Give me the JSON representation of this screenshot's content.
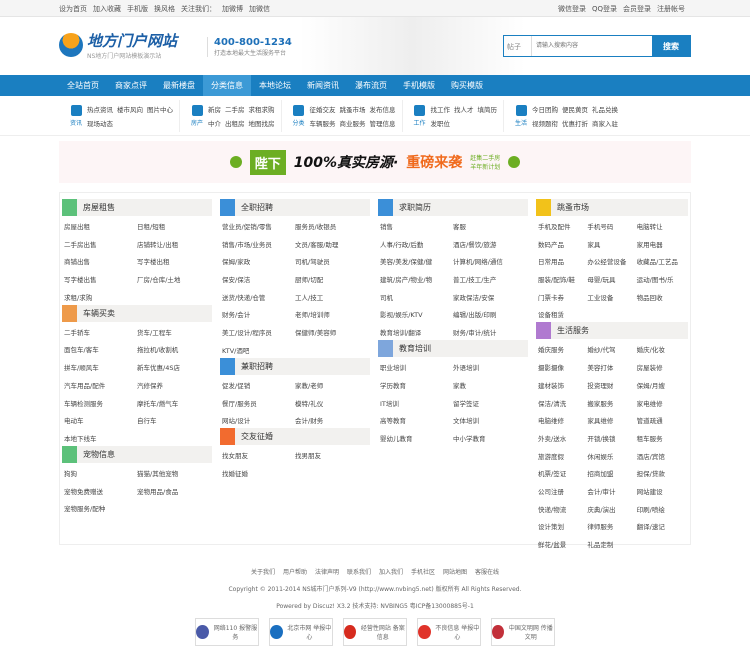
{
  "topbar": {
    "left": [
      "设为首页",
      "加入收藏",
      "手机版",
      "换风格",
      "关注我们：",
      "加微博",
      "加微信"
    ],
    "right": [
      "微信登录",
      "QQ登录",
      "会员登录",
      "注册帐号"
    ]
  },
  "header": {
    "logo_title": "地方门户网站",
    "logo_sub": "NS地方门户网站模板演示站",
    "phone": "400-800-1234",
    "slogan": "打造本地最大生活服务平台",
    "search_type": "帖子",
    "search_placeholder": "请输入搜索内容",
    "search_button": "搜索"
  },
  "nav": [
    "全站首页",
    "商家点评",
    "最新楼盘",
    "分类信息",
    "本地论坛",
    "新闻资讯",
    "瀑布流页",
    "手机模版",
    "购买模版"
  ],
  "subnav": [
    {
      "label": "资讯",
      "links": [
        "热点资讯",
        "楼市风向",
        "图片中心",
        "现场动态"
      ]
    },
    {
      "label": "房产",
      "links": [
        "新房",
        "二手房",
        "求租求购",
        "中介",
        "出租房",
        "地图找房"
      ]
    },
    {
      "label": "分类",
      "links": [
        "征婚交友",
        "跳蚤市场",
        "发布信息",
        "车辆服务",
        "商业服务",
        "管理信息"
      ]
    },
    {
      "label": "工作",
      "links": [
        "找工作",
        "找人才",
        "填简历",
        "发职位"
      ]
    },
    {
      "label": "生活",
      "links": [
        "今日团购",
        "便民黄页",
        "礼品兑换",
        "视频题衔",
        "优惠打折",
        "商家入驻"
      ]
    }
  ],
  "banner": {
    "tag": "陛下",
    "headline": "100%真实房源·",
    "highlight": "重磅来袭",
    "side": "赶集二手房 羊年新计划"
  },
  "columns": [
    [
      {
        "title": "房屋租售",
        "color": "#5cc17a",
        "items": [
          "房屋出租",
          "日租/短租",
          "二手房出售",
          "店铺转让/出租",
          "商铺出售",
          "写字楼出租",
          "写字楼出售",
          "厂房/仓库/土地",
          "求租/求购"
        ]
      },
      {
        "title": "车辆买卖",
        "color": "#ee9a4a",
        "items": [
          "二手轿车",
          "货车/工程车",
          "面包车/客车",
          "拖拉机/收割机",
          "拼车/顺风车",
          "新车优惠/4S店",
          "汽车用品/配件",
          "汽修保养",
          "车辆检测服务",
          "摩托车/燃气车",
          "电动车",
          "自行车",
          "本地下线车"
        ]
      },
      {
        "title": "宠物信息",
        "color": "#5cc17a",
        "items": [
          "狗狗",
          "猫猫/其他宠物",
          "宠物免费赠送",
          "宠物用品/食品",
          "宠物服务/配种"
        ]
      }
    ],
    [
      {
        "title": "全职招聘",
        "color": "#3b8fd8",
        "items": [
          "营业员/促销/零售",
          "服务员/收银员",
          "销售/市场/业务员",
          "文员/客服/助理",
          "保姆/家政",
          "司机/驾驶员",
          "保安/保洁",
          "厨师/切配",
          "送货/快递/仓管",
          "工人/技工",
          "财务/会计",
          "老师/培训师",
          "美工/设计/程序员",
          "保健师/美容师",
          "KTV/酒吧"
        ]
      },
      {
        "title": "兼职招聘",
        "color": "#3b8fd8",
        "items": [
          "促发/促销",
          "家教/老师",
          "餐厅/服务员",
          "模特/礼仪",
          "网站/设计",
          "会计/财务"
        ]
      },
      {
        "title": "交友征婚",
        "color": "#f26b2f",
        "items": [
          "找女朋友",
          "找男朋友",
          "找婚征婚"
        ]
      }
    ],
    [
      {
        "title": "求职简历",
        "color": "#3b8fd8",
        "items": [
          "销售",
          "客服",
          "人事/行政/后勤",
          "酒店/餐饮/旅游",
          "美容/美发/保健/健",
          "计算机/网络/通信",
          "建筑/房产/物业/物",
          "普工/技工/生产",
          "司机",
          "家政保洁/安保",
          "影视/娱乐/KTV",
          "编辑/出版/印刷",
          "教育培训/翻译",
          "财务/审计/统计"
        ]
      },
      {
        "title": "教育培训",
        "color": "#7ea6dc",
        "items": [
          "职业培训",
          "外语培训",
          "学历教育",
          "家教",
          "IT培训",
          "留学签证",
          "高等教育",
          "文体培训",
          "婴幼儿教育",
          "中小学教育"
        ]
      }
    ],
    [
      {
        "title": "跳蚤市场",
        "color": "#f2c21a",
        "three": true,
        "items": [
          "手机及配件",
          "手机号码",
          "电脑转让",
          "数码产品",
          "家具",
          "家用电器",
          "日常用品",
          "办公经营设备",
          "收藏品/工艺品",
          "服装/配饰/鞋",
          "母婴/玩具",
          "运动/图书/乐",
          "门票卡券",
          "工业设备",
          "物品回收",
          "设备租赁"
        ]
      },
      {
        "title": "生活服务",
        "color": "#b07ad0",
        "three": true,
        "items": [
          "婚庆服务",
          "婚纱/代驾",
          "婚庆/化妆",
          "摄影摄像",
          "美容打体",
          "房屋装修",
          "建材装饰",
          "投资理财",
          "保姆/月嫂",
          "保洁/清洗",
          "搬家服务",
          "家电维修",
          "电脑维修",
          "家具维修",
          "管道疏通",
          "外卖/送水",
          "开锁/换锁",
          "租车服务",
          "旅游度假",
          "休闲娱乐",
          "酒店/宾馆",
          "机票/签证",
          "招商加盟",
          "担保/贷款",
          "公司注册",
          "会计/审计",
          "网站建设",
          "快递/物流",
          "庆典/演出",
          "印刷/喷绘",
          "设计策划",
          "律师服务",
          "翻译/速记",
          "鲜花/盆景",
          "礼品定制"
        ]
      }
    ]
  ],
  "footer": {
    "links": [
      "关于我们",
      "用户帮助",
      "法律声明",
      "联系我们",
      "加入我们",
      "手机社区",
      "网站地图",
      "客服在线"
    ],
    "copyright": "Copyright © 2011-2014 NS城市门户系列-V9 (http://www.nvbing5.net) 版权所有 All Rights Reserved.",
    "powered": "Powered by Discuz! X3.2 技术支持: NVBING5 粤ICP备13000885号-1",
    "badges": [
      {
        "text": "网络110 报警服务",
        "color": "#4a5aa8"
      },
      {
        "text": "北京市网 举报中心",
        "color": "#1a6fc0"
      },
      {
        "text": "经营性网站 备案信息",
        "color": "#d62b1e"
      },
      {
        "text": "不良信息 举报中心",
        "color": "#e0332a"
      },
      {
        "text": "中国文明网 传播文明",
        "color": "#c2303a"
      }
    ]
  }
}
